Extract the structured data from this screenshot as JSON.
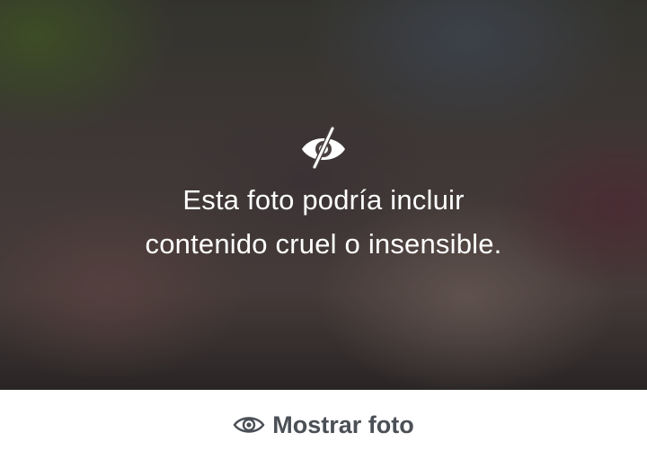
{
  "overlay": {
    "icon": "eye-slash-icon",
    "message_line1": "Esta foto podría incluir",
    "message_line2": "contenido cruel o insensible."
  },
  "action": {
    "icon": "eye-icon",
    "label": "Mostrar foto",
    "label_color": "#4b4f56"
  }
}
